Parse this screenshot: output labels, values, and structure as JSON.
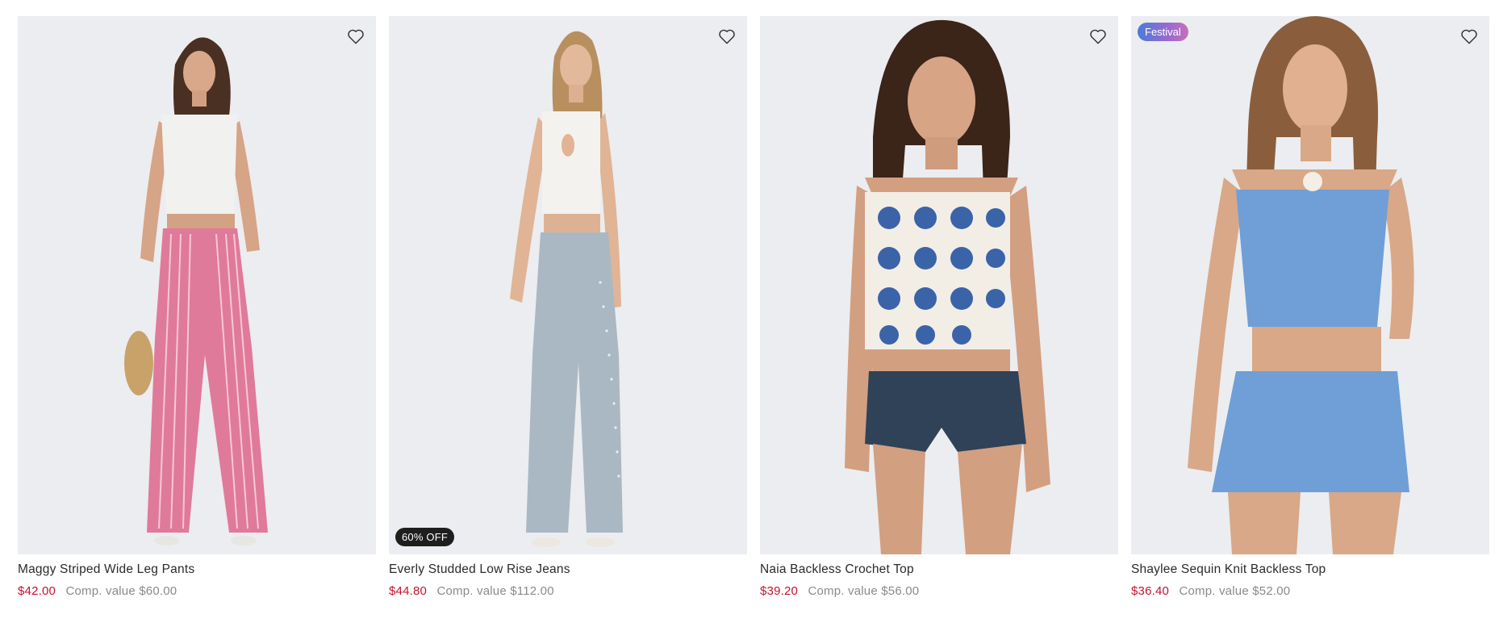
{
  "products": [
    {
      "name": "Maggy Striped Wide Leg Pants",
      "price": "$42.00",
      "comp_value": "Comp. value $60.00",
      "badge": "",
      "wishlist_icon": "heart-outline-icon"
    },
    {
      "name": "Everly Studded Low Rise Jeans",
      "price": "$44.80",
      "comp_value": "Comp. value $112.00",
      "badge": "60% OFF",
      "wishlist_icon": "heart-outline-icon"
    },
    {
      "name": "Naia Backless Crochet Top",
      "price": "$39.20",
      "comp_value": "Comp. value $56.00",
      "badge": "",
      "wishlist_icon": "heart-outline-icon"
    },
    {
      "name": "Shaylee Sequin Knit Backless Top",
      "price": "$36.40",
      "comp_value": "Comp. value $52.00",
      "badge": "Festival",
      "wishlist_icon": "heart-outline-icon"
    }
  ],
  "colors": {
    "sale_price": "#c8102e",
    "comp_value": "#8a8a8a",
    "image_bg": "#ebedf0"
  }
}
